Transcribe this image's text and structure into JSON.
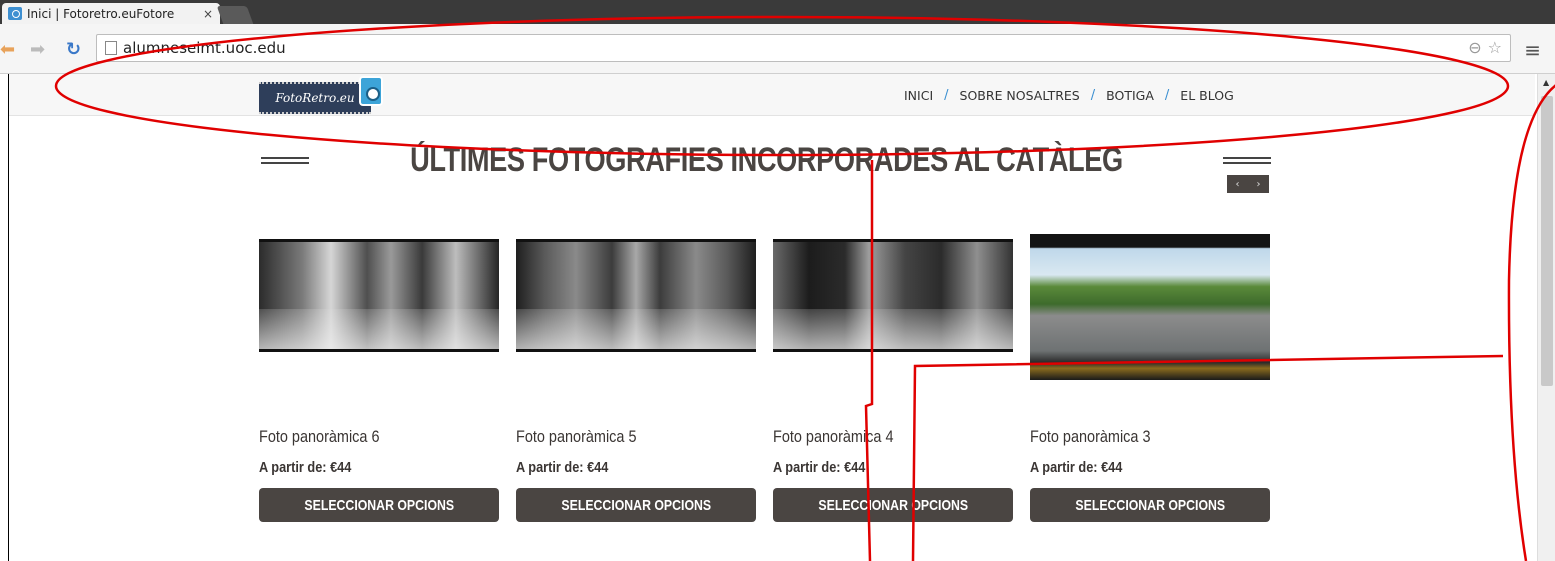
{
  "browser": {
    "tab_title": "Inici | Fotoretro.euFotore",
    "tab_close": "×",
    "url": "alumneseimt.uoc.edu"
  },
  "site": {
    "logo_text": "FotoRetro.eu",
    "nav": [
      "INICI",
      "SOBRE NOSALTRES",
      "BOTIGA",
      "EL BLOG"
    ],
    "nav_separator": "/",
    "section_title": "ÚLTIMES FOTOGRAFIES INCORPORADES AL CATÀLEG",
    "carousel_prev": "‹",
    "carousel_next": "›"
  },
  "products": [
    {
      "name": "Foto panoràmica 6",
      "price": "A partir de: €44",
      "button": "SELECCIONAR OPCIONS",
      "image": "bw"
    },
    {
      "name": "Foto panoràmica 5",
      "price": "A partir de: €44",
      "button": "SELECCIONAR OPCIONS",
      "image": "bw"
    },
    {
      "name": "Foto panoràmica 4",
      "price": "A partir de: €44",
      "button": "SELECCIONAR OPCIONS",
      "image": "bw"
    },
    {
      "name": "Foto panoràmica 3",
      "price": "A partir de: €44",
      "button": "SELECCIONAR OPCIONS",
      "image": "color"
    }
  ],
  "colors": {
    "annotation": "#e00000",
    "button_bg": "#4a4542",
    "nav_separator": "#3a8fd1"
  }
}
